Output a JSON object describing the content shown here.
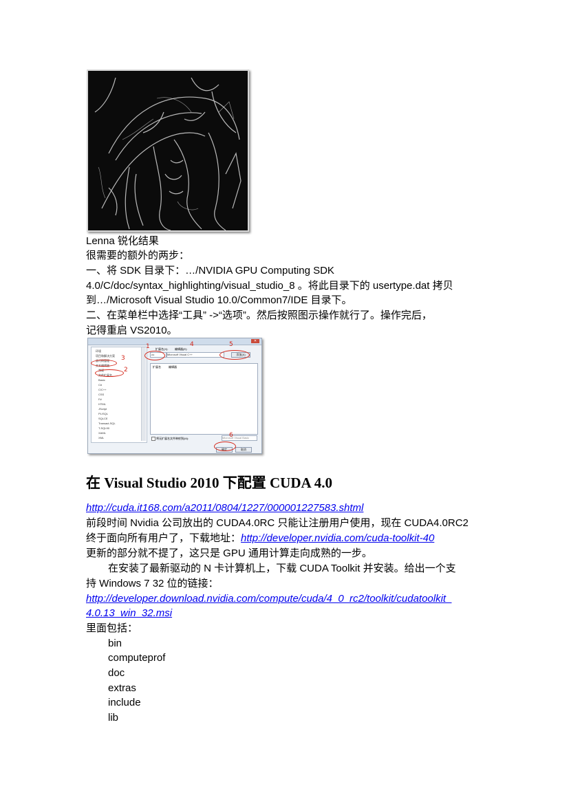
{
  "lenna_caption": "Lenna 锐化结果",
  "para1": {
    "line1": "很需要的额外的两步：",
    "line2": "一、将 SDK 目录下：…/NVIDIA GPU Computing SDK",
    "line3": "4.0/C/doc/syntax_highlighting/visual_studio_8 。将此目录下的 usertype.dat 拷贝",
    "line4": "到…/Microsoft Visual Studio 10.0/Common7/IDE 目录下。",
    "line5": "二、在菜单栏中选择“工具” ->“选项”。然后按照图示操作就行了。操作完后，",
    "line6": "记得重启 VS2010。"
  },
  "dialog": {
    "tree_items": [
      "环境",
      "项目和解决方案",
      "源代码管理",
      "文本编辑器",
      "常规",
      "文件扩展名",
      "Basic",
      "C#",
      "C/C++",
      "CSS",
      "F#",
      "HTML",
      "JScript",
      "PL/SQL",
      "SQLCE",
      "Transact-SQL",
      "T-SQL90",
      "XAML",
      "XML"
    ],
    "ext_label": "扩展名(X):",
    "editor_label": "编辑器(E):",
    "ext_value": ".cu",
    "editor_value": "Microsoft Visual C++",
    "add_button": "添加(A)",
    "col_ext": "扩展名",
    "col_editor": "编辑器",
    "checkbox_label": "将无扩展名文件映射到(M):",
    "map_value": "Microsoft Visual Basic",
    "ok_button": "确定",
    "cancel_button": "取消",
    "annotations": [
      "1",
      "2",
      "3",
      "4",
      "5",
      "6"
    ]
  },
  "heading": "在 Visual Studio 2010 下配置 CUDA 4.0",
  "body": {
    "url1": "http://cuda.it168.com/a2011/0804/1227/000001227583.shtml",
    "line1": "前段时间 Nvidia 公司放出的 CUDA4.0RC 只能让注册用户使用，现在 CUDA4.0RC2",
    "line2_prefix": "终于面向所有用户了，下载地址：",
    "line2_link": "http://developer.nvidia.com/cuda-toolkit-40",
    "line3": "更新的部分就不提了，这只是 GPU 通用计算走向成熟的一步。",
    "line4": "在安装了最新驱动的 N 卡计算机上，下载 CUDA Toolkit 并安装。给出一个支",
    "line5": "持 Windows 7 32 位的链接：",
    "url2a": "http://developer.download.nvidia.com/compute/cuda/4_0_rc2/toolkit/cudatoolkit_",
    "url2b": "4.0.13_win_32.msi",
    "line6": "里面包括：",
    "items": [
      "bin",
      "computeprof",
      "doc",
      "extras",
      "include",
      "lib"
    ]
  }
}
